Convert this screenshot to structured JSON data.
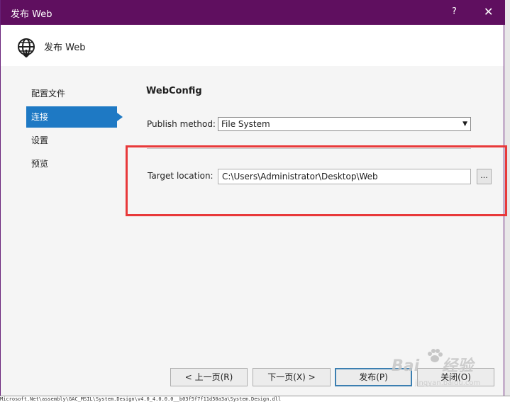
{
  "window": {
    "title": "发布 Web",
    "help_label": "?",
    "close_label": "✕"
  },
  "header": {
    "title": "发布 Web",
    "icon": "globe-publish-icon"
  },
  "nav": {
    "items": [
      {
        "label": "配置文件"
      },
      {
        "label": "连接"
      },
      {
        "label": "设置"
      },
      {
        "label": "预览"
      }
    ],
    "active_index": 1
  },
  "main": {
    "section_title": "WebConfig",
    "publish_method": {
      "label": "Publish method:",
      "value": "File System"
    },
    "target_location": {
      "label": "Target location:",
      "value": "C:\\Users\\Administrator\\Desktop\\Web",
      "browse_label": "..."
    }
  },
  "footer": {
    "prev_label": "< 上一页(R)",
    "next_label": "下一页(X) >",
    "publish_label": "发布(P)",
    "close_label": "关闭(O)"
  },
  "background_text": "Microsoft.Net\\assembly\\GAC_MSIL\\System.Design\\v4.0_4.0.0.0__b03f5f7f11d50a3a\\System.Design.dll",
  "watermark": {
    "brand": "Bai",
    "brand_suffix": "经验",
    "url": "jingyan.baidu.com"
  },
  "colors": {
    "titlebar": "#5f0f5f",
    "accent": "#1e79c4",
    "highlight_box": "#e8393a"
  }
}
